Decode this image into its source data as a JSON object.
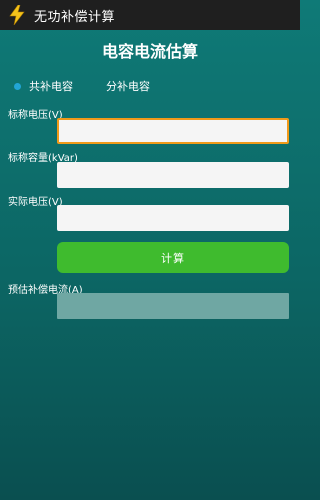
{
  "app": {
    "title": "无功补偿计算",
    "icon": "lightning-icon"
  },
  "page": {
    "title": "电容电流估算"
  },
  "mode": {
    "options": [
      {
        "label": "共补电容",
        "checked": true
      },
      {
        "label": "分补电容",
        "checked": false
      }
    ]
  },
  "fields": {
    "rated_voltage": {
      "label": "标称电压(V)",
      "value": ""
    },
    "rated_capacity": {
      "label": "标称容量(kVar)",
      "value": ""
    },
    "actual_voltage": {
      "label": "实际电压(V)",
      "value": ""
    }
  },
  "actions": {
    "calculate_label": "计算"
  },
  "result": {
    "label": "预估补偿电流(A)",
    "value": ""
  },
  "colors": {
    "accent_green": "#3fbb2e",
    "focus_orange": "#f09a1a",
    "radio_blue": "#22a6d6",
    "background_teal": "#0f7a77"
  }
}
